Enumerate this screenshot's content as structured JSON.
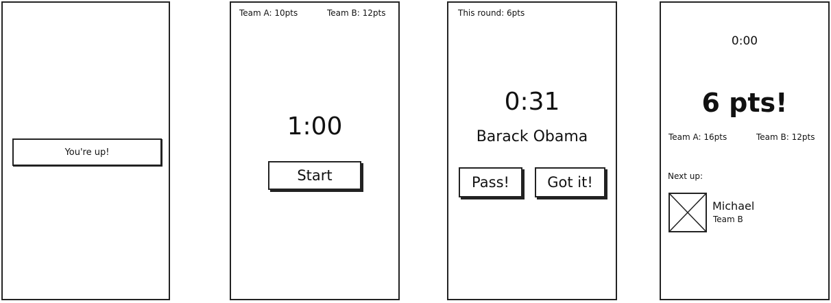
{
  "screen1": {
    "your_turn_button": "You're up!"
  },
  "screen2": {
    "team_a_score": "Team A: 10pts",
    "team_b_score": "Team B: 12pts",
    "timer": "1:00",
    "start_button": "Start"
  },
  "screen3": {
    "round_score": "This round: 6pts",
    "timer": "0:31",
    "word": "Barack Obama",
    "pass_button": "Pass!",
    "got_it_button": "Got it!"
  },
  "screen4": {
    "timer": "0:00",
    "round_points": "6 pts!",
    "team_a_score": "Team A: 16pts",
    "team_b_score": "Team B: 12pts",
    "next_up_label": "Next up:",
    "next_player": {
      "name": "Michael",
      "team": "Team B",
      "avatar_icon": "image-placeholder-icon"
    }
  }
}
